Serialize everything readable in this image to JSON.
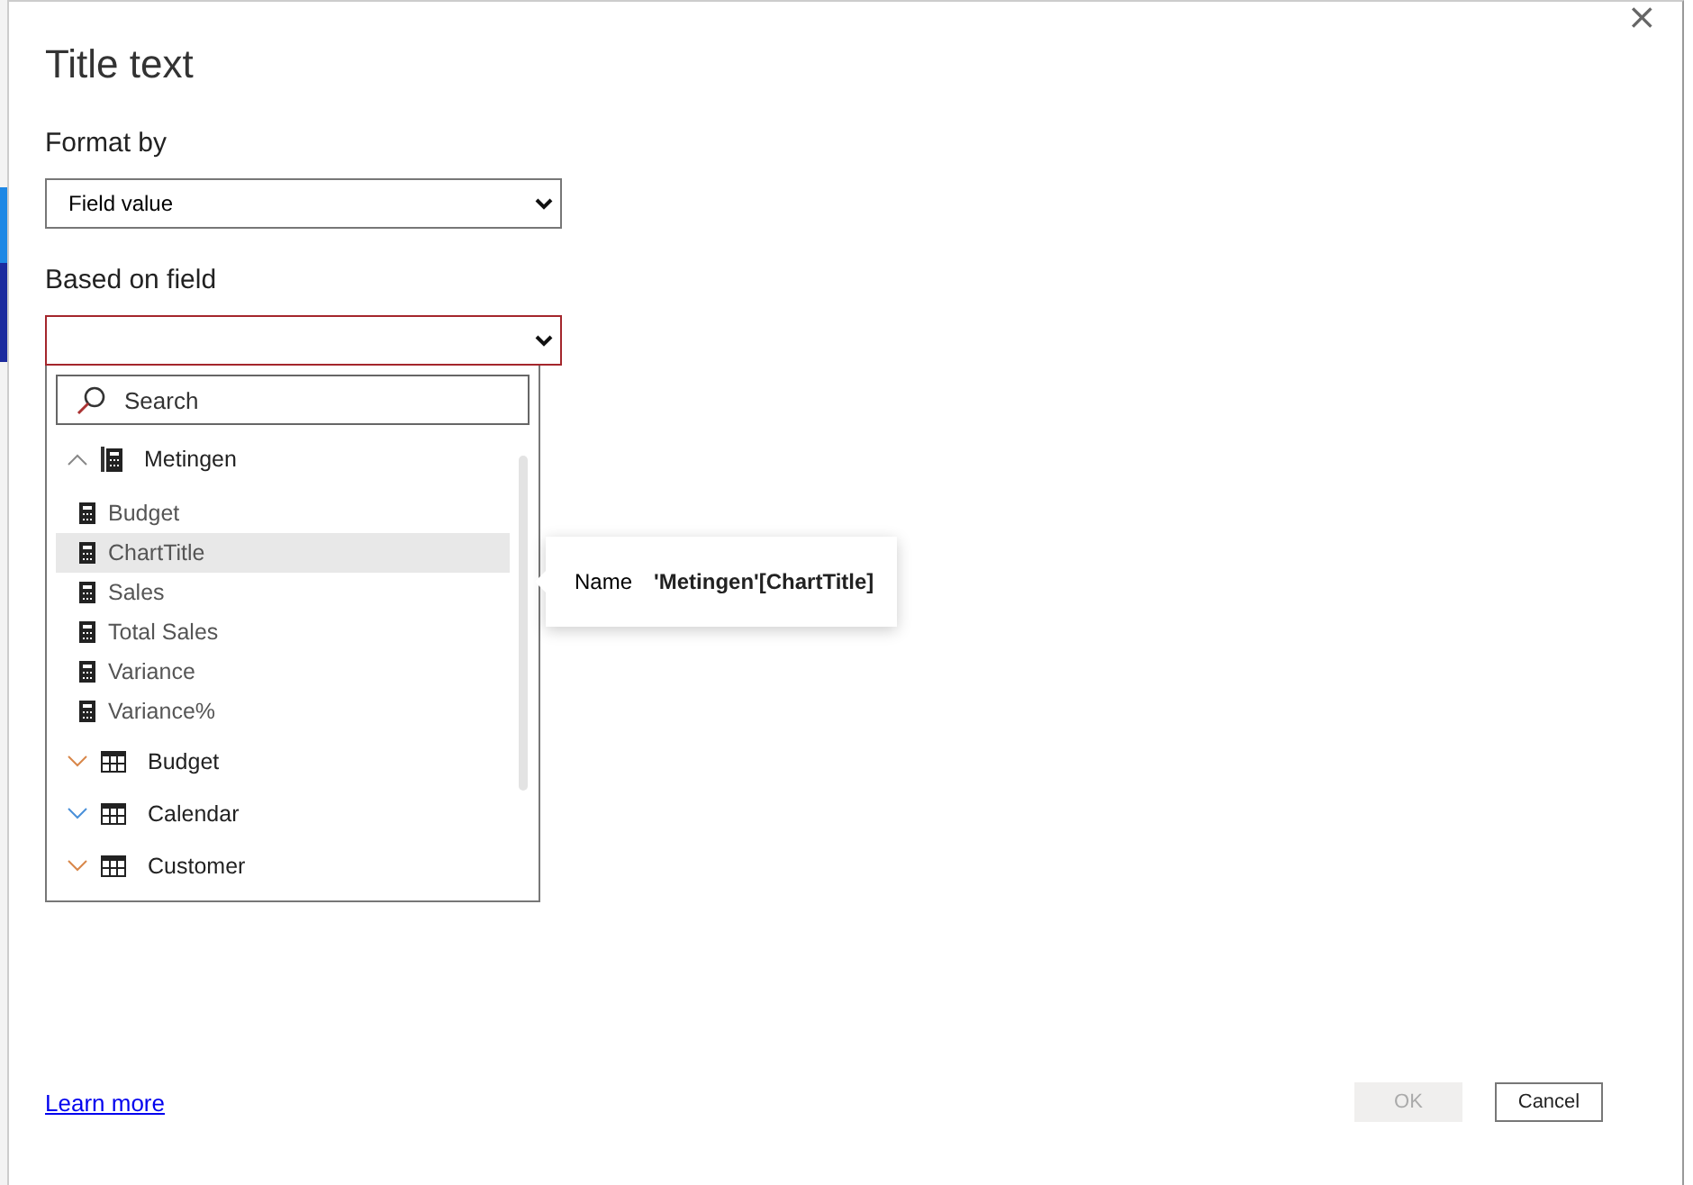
{
  "dialog": {
    "title": "Title text",
    "close": "×"
  },
  "format_by": {
    "label": "Format by",
    "value": "Field value"
  },
  "based_on_field": {
    "label": "Based on field",
    "invalid": true
  },
  "dropdown": {
    "search": {
      "placeholder": "Search"
    },
    "groups": [
      {
        "name": "Metingen",
        "kind": "measures",
        "expanded": true,
        "children": [
          {
            "name": "Budget",
            "selected": false
          },
          {
            "name": "ChartTitle",
            "selected": true
          },
          {
            "name": "Sales",
            "selected": false
          },
          {
            "name": "Total Sales",
            "selected": false
          },
          {
            "name": "Variance",
            "selected": false
          },
          {
            "name": "Variance%",
            "selected": false
          }
        ]
      },
      {
        "name": "Budget",
        "kind": "table",
        "expanded": false
      },
      {
        "name": "Calendar",
        "kind": "table",
        "expanded": false
      },
      {
        "name": "Customer",
        "kind": "table",
        "expanded": false
      }
    ]
  },
  "tooltip": {
    "label": "Name",
    "value": "'Metingen'[ChartTitle]"
  },
  "footer": {
    "link": "Learn more",
    "buttons": [
      {
        "label": "OK",
        "disabled": true
      },
      {
        "label": "Cancel",
        "disabled": false
      }
    ]
  }
}
